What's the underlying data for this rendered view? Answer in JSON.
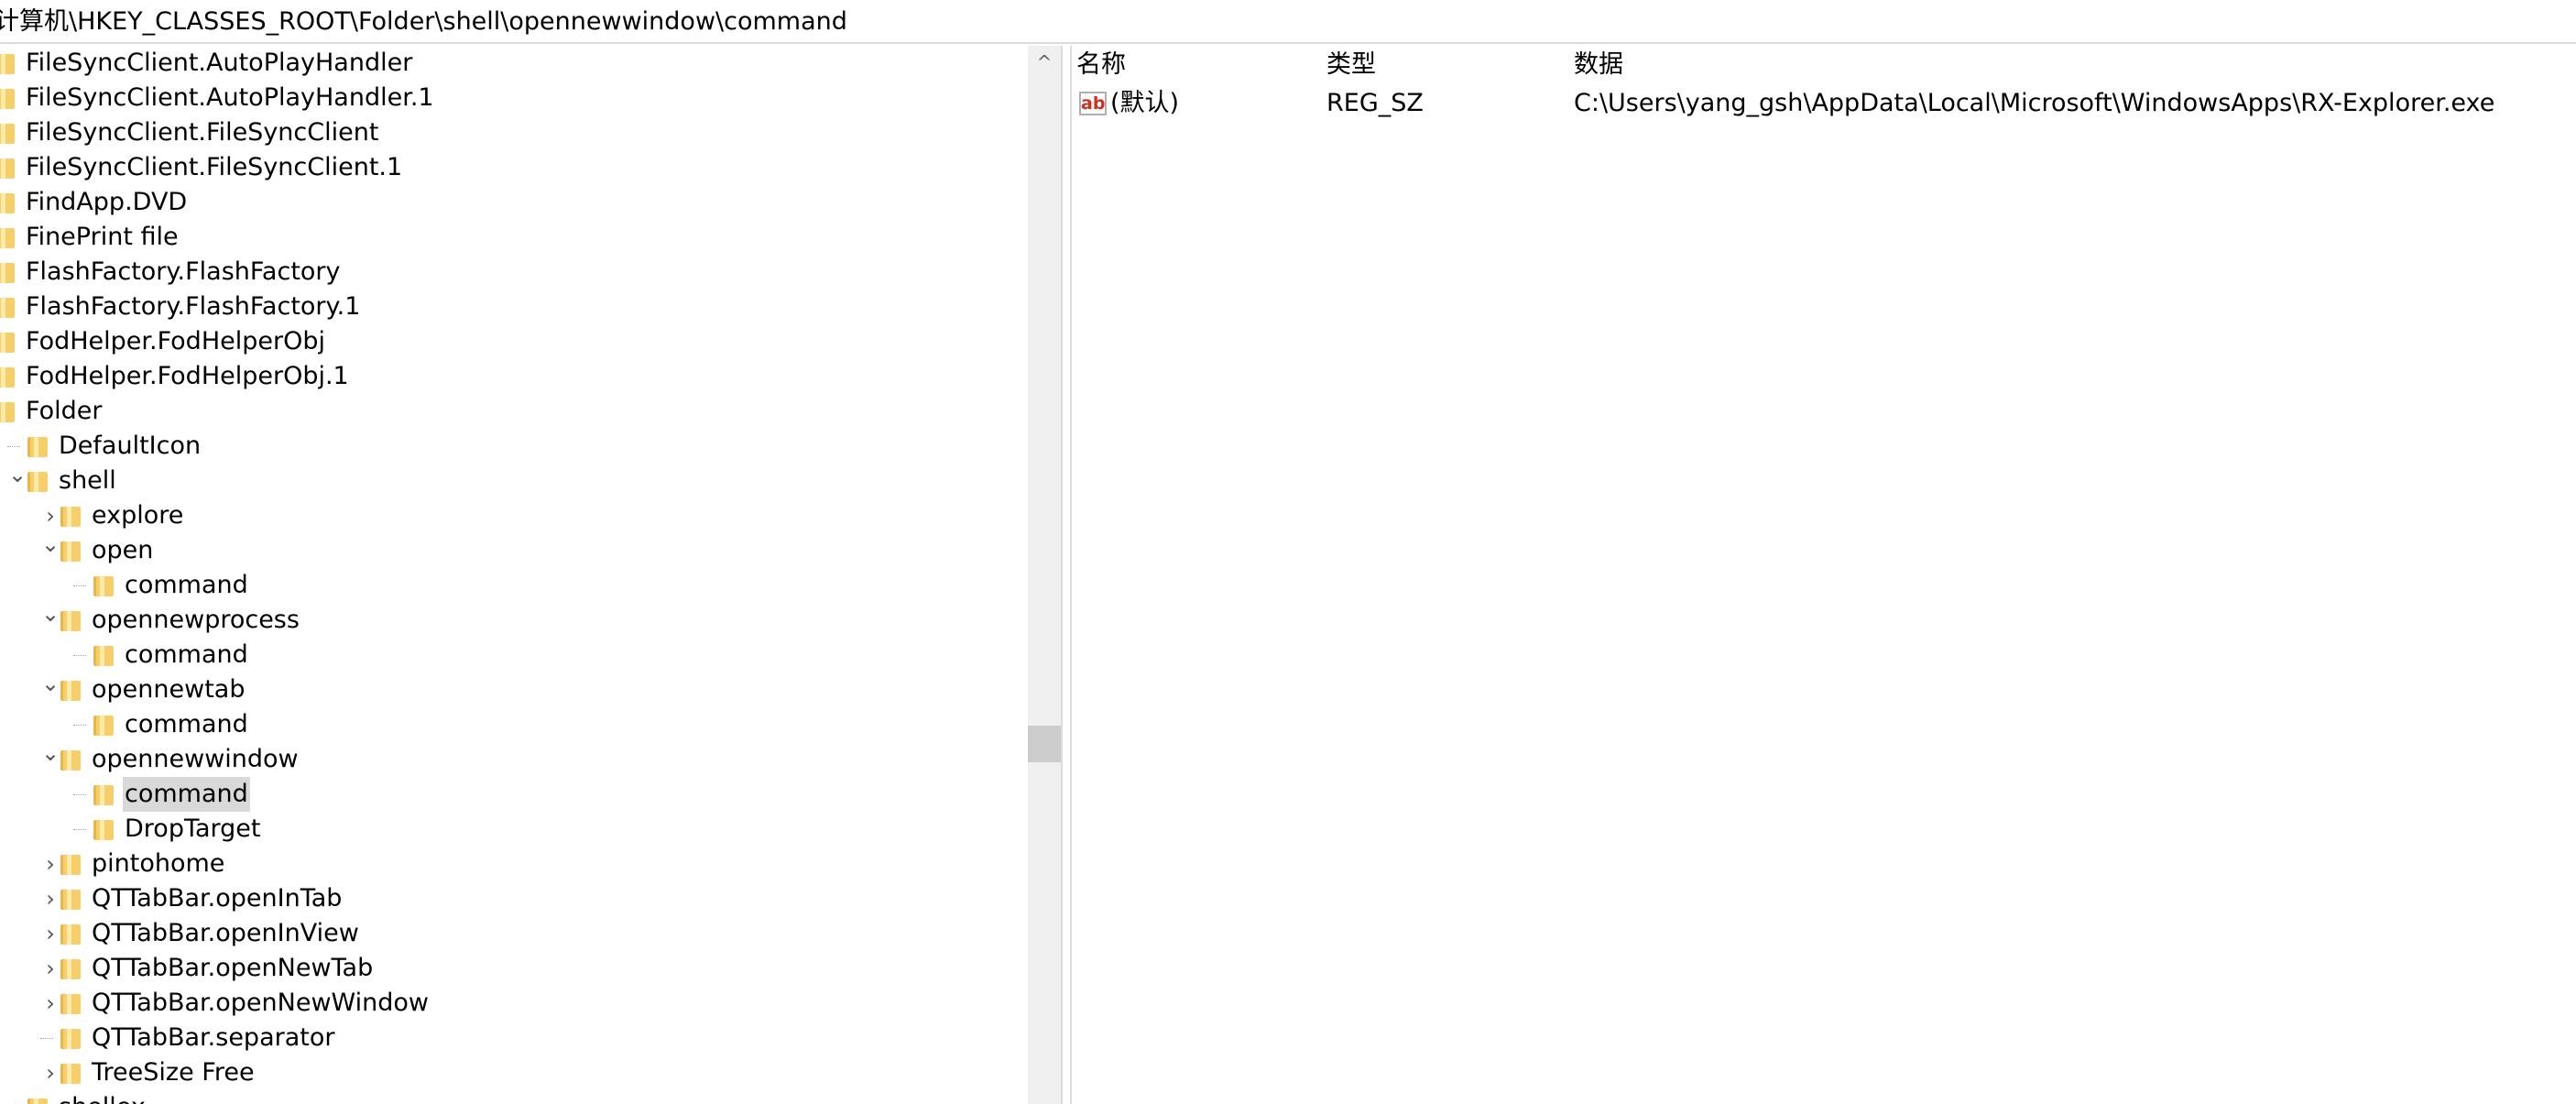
{
  "address": "计算机\\HKEY_CLASSES_ROOT\\Folder\\shell\\opennewwindow\\command",
  "tree": [
    {
      "label": "FileSyncClient.AutoPlayHandler",
      "depth": 0,
      "expand": ""
    },
    {
      "label": "FileSyncClient.AutoPlayHandler.1",
      "depth": 0,
      "expand": ""
    },
    {
      "label": "FileSyncClient.FileSyncClient",
      "depth": 0,
      "expand": ""
    },
    {
      "label": "FileSyncClient.FileSyncClient.1",
      "depth": 0,
      "expand": ""
    },
    {
      "label": "FindApp.DVD",
      "depth": 0,
      "expand": ""
    },
    {
      "label": "FinePrint file",
      "depth": 0,
      "expand": ""
    },
    {
      "label": "FlashFactory.FlashFactory",
      "depth": 0,
      "expand": ""
    },
    {
      "label": "FlashFactory.FlashFactory.1",
      "depth": 0,
      "expand": ""
    },
    {
      "label": "FodHelper.FodHelperObj",
      "depth": 0,
      "expand": ""
    },
    {
      "label": "FodHelper.FodHelperObj.1",
      "depth": 0,
      "expand": ""
    },
    {
      "label": "Folder",
      "depth": 0,
      "expand": ""
    },
    {
      "label": "DefaultIcon",
      "depth": 1,
      "expand": ""
    },
    {
      "label": "shell",
      "depth": 1,
      "expand": "v"
    },
    {
      "label": "explore",
      "depth": 2,
      "expand": ">"
    },
    {
      "label": "open",
      "depth": 2,
      "expand": "v"
    },
    {
      "label": "command",
      "depth": 3,
      "expand": ""
    },
    {
      "label": "opennewprocess",
      "depth": 2,
      "expand": "v"
    },
    {
      "label": "command",
      "depth": 3,
      "expand": ""
    },
    {
      "label": "opennewtab",
      "depth": 2,
      "expand": "v"
    },
    {
      "label": "command",
      "depth": 3,
      "expand": ""
    },
    {
      "label": "opennewwindow",
      "depth": 2,
      "expand": "v"
    },
    {
      "label": "command",
      "depth": 3,
      "expand": "",
      "selected": true
    },
    {
      "label": "DropTarget",
      "depth": 3,
      "expand": ""
    },
    {
      "label": "pintohome",
      "depth": 2,
      "expand": ">"
    },
    {
      "label": "QTTabBar.openInTab",
      "depth": 2,
      "expand": ">"
    },
    {
      "label": "QTTabBar.openInView",
      "depth": 2,
      "expand": ">"
    },
    {
      "label": "QTTabBar.openNewTab",
      "depth": 2,
      "expand": ">"
    },
    {
      "label": "QTTabBar.openNewWindow",
      "depth": 2,
      "expand": ">"
    },
    {
      "label": "QTTabBar.separator",
      "depth": 2,
      "expand": ""
    },
    {
      "label": "TreeSize Free",
      "depth": 2,
      "expand": ">"
    },
    {
      "label": "shellex",
      "depth": 1,
      "expand": ">"
    }
  ],
  "list": {
    "headers": {
      "name": "名称",
      "type": "类型",
      "data": "数据"
    },
    "rows": [
      {
        "name": "(默认)",
        "type": "REG_SZ",
        "data": "C:\\Users\\yang_gsh\\AppData\\Local\\Microsoft\\WindowsApps\\RX-Explorer.exe",
        "icon": "ab"
      }
    ]
  },
  "scrollbar": {
    "up_arrow": "^"
  }
}
